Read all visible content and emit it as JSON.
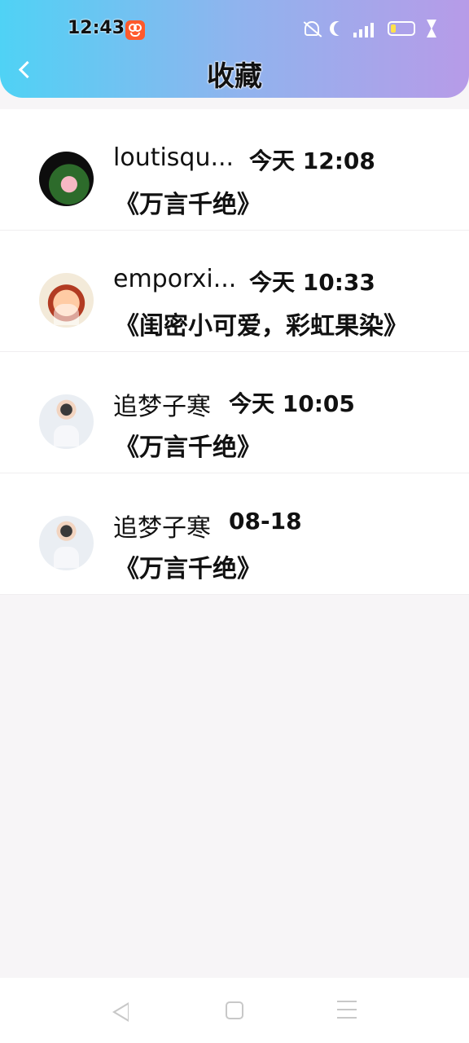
{
  "status_bar": {
    "time": "12:43"
  },
  "header": {
    "title": "收藏",
    "back_icon": "chevron-left-icon"
  },
  "items": [
    {
      "username": "loutisqu...",
      "date": "今天 12:08",
      "work": "《万言千绝》",
      "avatar": "lotus"
    },
    {
      "username": "emporxi...",
      "date": "今天 10:33",
      "work": "《闺密小可爱，彩虹果染》",
      "avatar": "doll"
    },
    {
      "username": "追梦子寒",
      "date": "今天 10:05",
      "work": "《万言千绝》",
      "avatar": "boy"
    },
    {
      "username": "追梦子寒",
      "date": "08-18",
      "work": "《万言千绝》",
      "avatar": "boy"
    }
  ],
  "colors": {
    "header_gradient_start": "#4fd2f5",
    "header_gradient_end": "#b79be8",
    "background": "#f7f5f7"
  }
}
